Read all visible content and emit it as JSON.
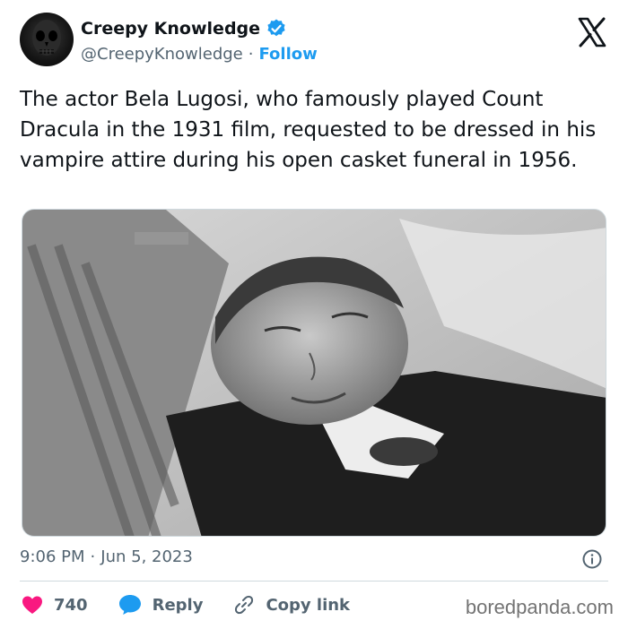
{
  "account": {
    "display_name": "Creepy Knowledge",
    "handle": "@CreepyKnowledge",
    "separator": "·",
    "follow_label": "Follow",
    "verified_color": "#1d9bf0"
  },
  "tweet": {
    "text": "The actor Bela Lugosi, who famously played Count Dracula in the 1931 film, requested to be dressed in his vampire attire during his open casket funeral in 1956."
  },
  "meta": {
    "time": "9:06 PM",
    "separator": "·",
    "date": "Jun 5, 2023"
  },
  "actions": {
    "like_count": "740",
    "reply_label": "Reply",
    "copy_link_label": "Copy link"
  },
  "watermark": "boredpanda.com",
  "icons": [
    "x-logo-icon",
    "verified-badge-icon",
    "info-icon",
    "heart-icon",
    "reply-icon",
    "link-icon"
  ],
  "colors": {
    "accent": "#1d9bf0",
    "like": "#f91880",
    "secondary_text": "#536471"
  }
}
